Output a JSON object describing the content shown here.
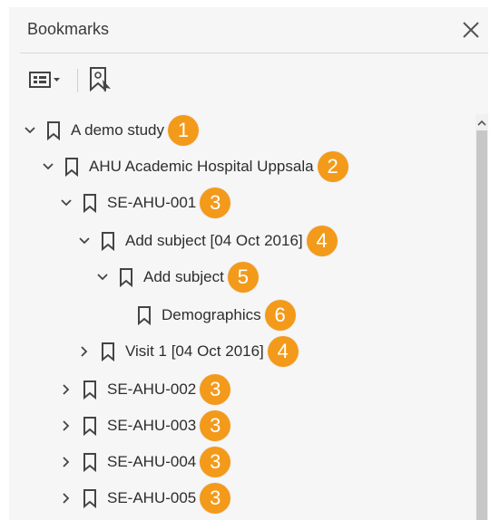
{
  "panel": {
    "title": "Bookmarks"
  },
  "icons": {
    "close": "close-icon",
    "options": "list-options-icon",
    "new_bookmark": "new-bookmark-icon",
    "bookmark": "bookmark-icon",
    "expanded": "chevron-down-icon",
    "collapsed": "chevron-right-icon"
  },
  "colors": {
    "badge": "#f39a1b",
    "accent_text": "#2e2e2e"
  },
  "bookmarks": [
    {
      "label": "A demo study",
      "badge": "1",
      "state": "expanded"
    },
    {
      "label": "AHU Academic Hospital Uppsala",
      "badge": "2",
      "state": "expanded"
    },
    {
      "label": "SE-AHU-001",
      "badge": "3",
      "state": "expanded"
    },
    {
      "label": "Add subject [04 Oct 2016]",
      "badge": "4",
      "state": "expanded"
    },
    {
      "label": "Add subject",
      "badge": "5",
      "state": "expanded"
    },
    {
      "label": "Demographics",
      "badge": "6",
      "state": "leaf"
    },
    {
      "label": "Visit 1 [04 Oct 2016]",
      "badge": "4",
      "state": "collapsed"
    },
    {
      "label": "SE-AHU-002",
      "badge": "3",
      "state": "collapsed"
    },
    {
      "label": "SE-AHU-003",
      "badge": "3",
      "state": "collapsed"
    },
    {
      "label": "SE-AHU-004",
      "badge": "3",
      "state": "collapsed"
    },
    {
      "label": "SE-AHU-005",
      "badge": "3",
      "state": "collapsed"
    }
  ]
}
